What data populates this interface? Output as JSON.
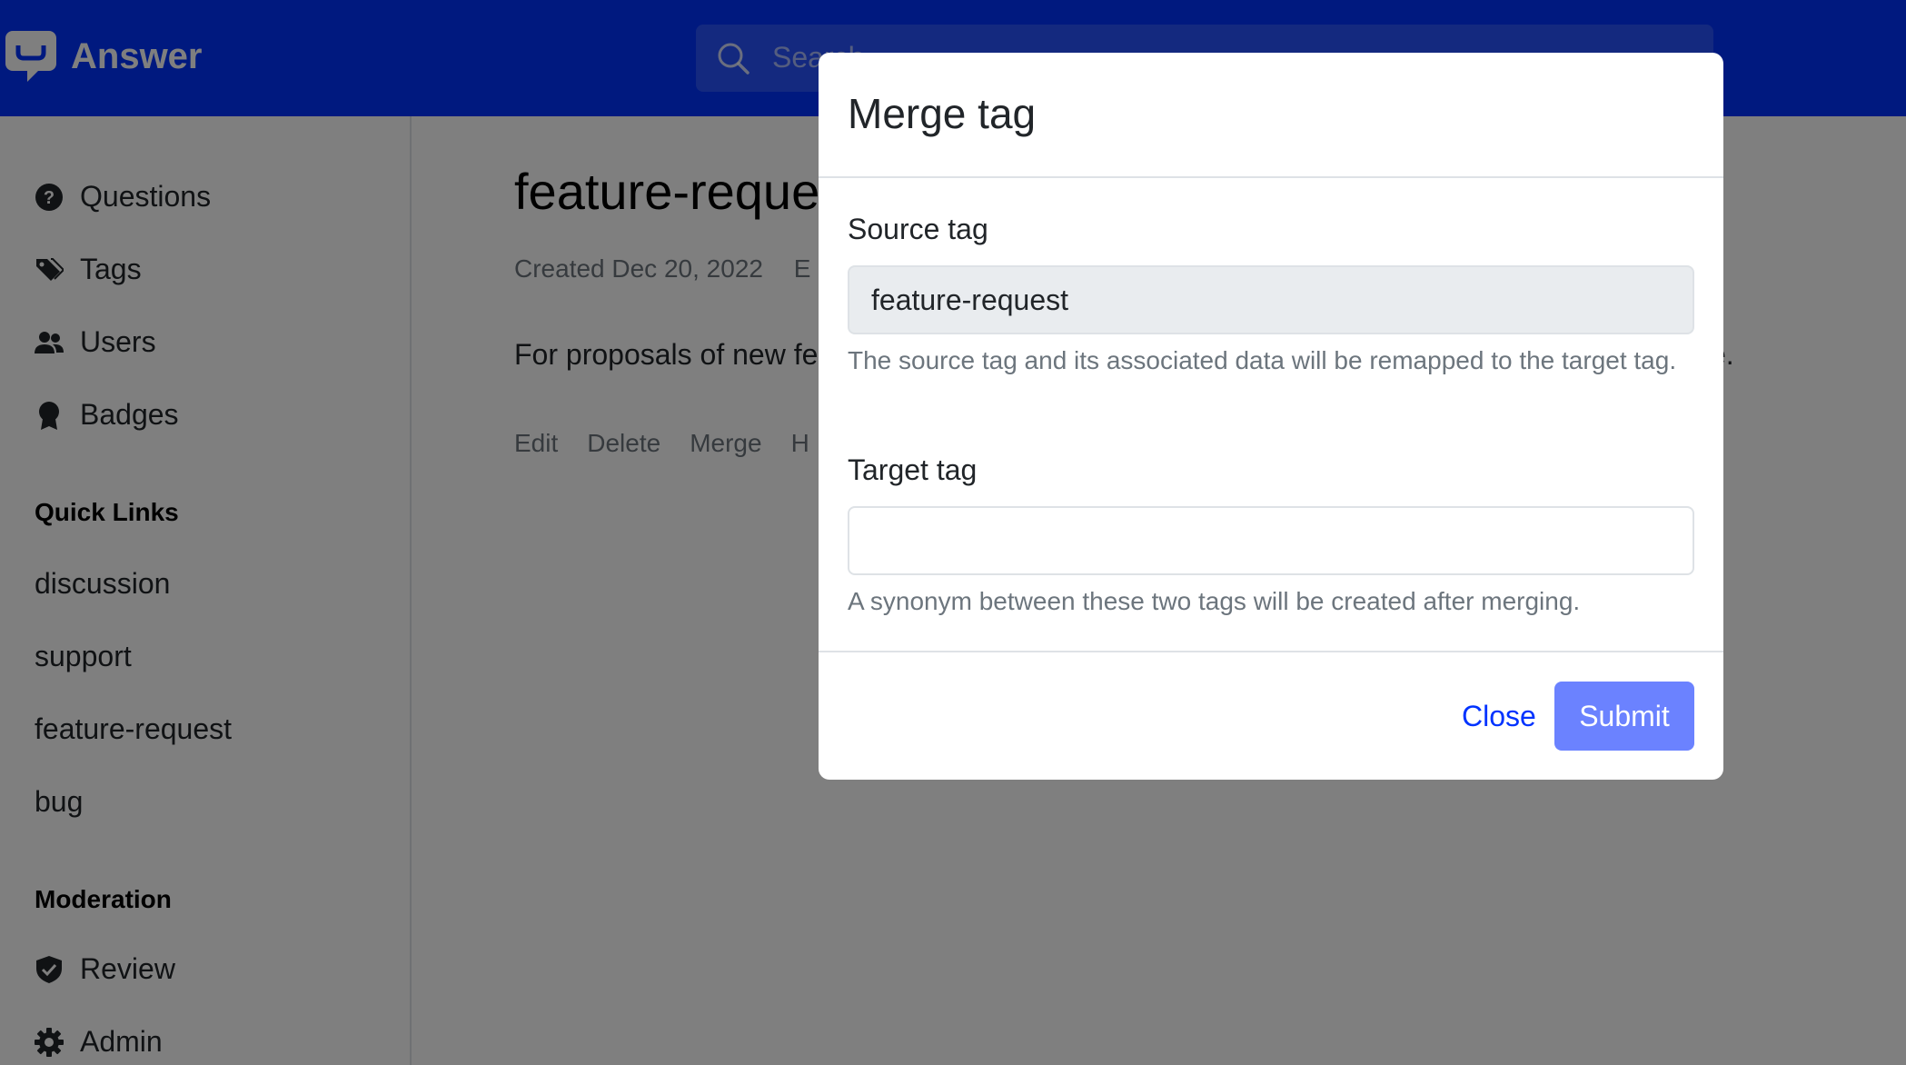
{
  "app": {
    "name": "Answer"
  },
  "search": {
    "placeholder": "Search"
  },
  "sidebar": {
    "nav": [
      {
        "label": "Questions",
        "icon": "question-circle-icon"
      },
      {
        "label": "Tags",
        "icon": "tags-icon"
      },
      {
        "label": "Users",
        "icon": "users-icon"
      },
      {
        "label": "Badges",
        "icon": "award-icon"
      }
    ],
    "quick_links_title": "Quick Links",
    "quick_links": [
      "discussion",
      "support",
      "feature-request",
      "bug"
    ],
    "moderation_title": "Moderation",
    "moderation": [
      {
        "label": "Review",
        "icon": "shield-check-icon"
      },
      {
        "label": "Admin",
        "icon": "gear-icon"
      }
    ]
  },
  "main": {
    "title": "feature-reque",
    "meta": "Created Dec 20, 2022",
    "meta_tail": "E",
    "description": "For proposals of new fe",
    "description_end": "e.",
    "actions": [
      "Edit",
      "Delete",
      "Merge",
      "H"
    ]
  },
  "modal": {
    "title": "Merge tag",
    "source_label": "Source tag",
    "source_value": "feature-request",
    "source_help": "The source tag and its associated data will be remapped to the target tag.",
    "target_label": "Target tag",
    "target_value": "",
    "target_help": "A synonym between these two tags will be created after merging.",
    "close_label": "Close",
    "submit_label": "Submit"
  },
  "colors": {
    "brand": "#0033ff",
    "submit": "#6b82ff",
    "backdrop": "rgba(0,0,0,0.5)"
  }
}
